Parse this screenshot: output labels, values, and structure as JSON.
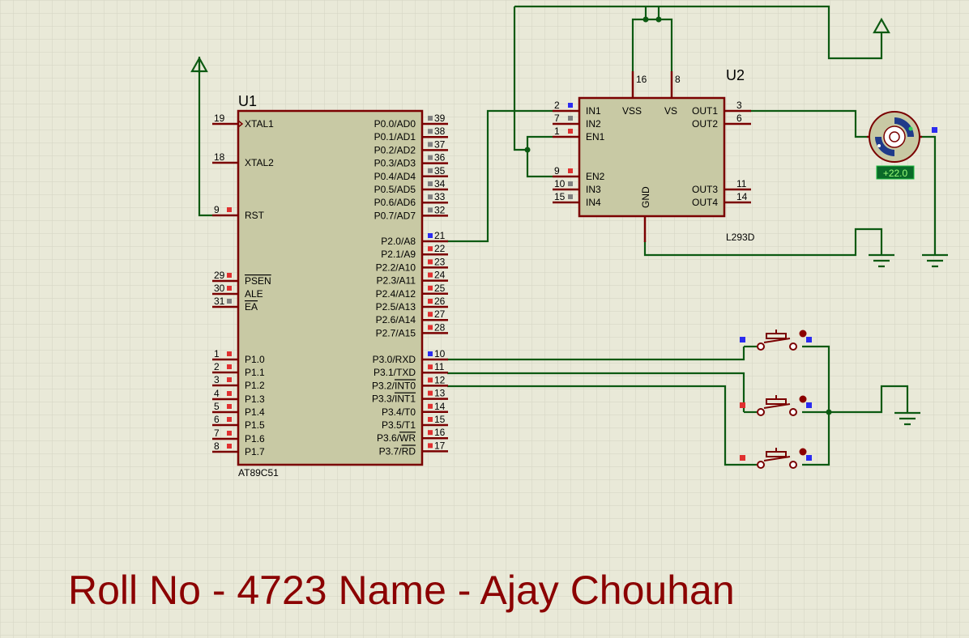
{
  "colors": {
    "background": "#e9e9d8",
    "grid": "#d4d4c2",
    "chip_fill": "#c8c9a4",
    "chip_border": "#7a0000",
    "wire": "#0c5a12",
    "footer_text": "#8b0000",
    "pin_marker_red": "#e03030",
    "pin_marker_blue": "#2b2bf0",
    "pin_marker_gray": "#808080"
  },
  "u1": {
    "ref": "U1",
    "part": "AT89C51",
    "left_pins": [
      {
        "num": "19",
        "label": "XTAL1",
        "clock": true
      },
      {
        "num": "18",
        "label": "XTAL2"
      },
      {
        "num": "9",
        "label": "RST",
        "marker": "red"
      },
      {
        "num": "29",
        "label": "PSEN",
        "overline": true,
        "marker": "red"
      },
      {
        "num": "30",
        "label": "ALE",
        "marker": "red"
      },
      {
        "num": "31",
        "label": "EA",
        "overline": true,
        "marker": "gray"
      },
      {
        "num": "1",
        "label": "P1.0",
        "marker": "red"
      },
      {
        "num": "2",
        "label": "P1.1",
        "marker": "red"
      },
      {
        "num": "3",
        "label": "P1.2",
        "marker": "red"
      },
      {
        "num": "4",
        "label": "P1.3",
        "marker": "red"
      },
      {
        "num": "5",
        "label": "P1.4",
        "marker": "red"
      },
      {
        "num": "6",
        "label": "P1.5",
        "marker": "red"
      },
      {
        "num": "7",
        "label": "P1.6",
        "marker": "red"
      },
      {
        "num": "8",
        "label": "P1.7",
        "marker": "red"
      }
    ],
    "right_pins": [
      {
        "num": "39",
        "label": "P0.0/AD0",
        "marker": "gray"
      },
      {
        "num": "38",
        "label": "P0.1/AD1",
        "marker": "gray"
      },
      {
        "num": "37",
        "label": "P0.2/AD2",
        "marker": "gray"
      },
      {
        "num": "36",
        "label": "P0.3/AD3",
        "marker": "gray"
      },
      {
        "num": "35",
        "label": "P0.4/AD4",
        "marker": "gray"
      },
      {
        "num": "34",
        "label": "P0.5/AD5",
        "marker": "gray"
      },
      {
        "num": "33",
        "label": "P0.6/AD6",
        "marker": "gray"
      },
      {
        "num": "32",
        "label": "P0.7/AD7",
        "marker": "gray"
      },
      {
        "num": "21",
        "label": "P2.0/A8",
        "marker": "blue"
      },
      {
        "num": "22",
        "label": "P2.1/A9",
        "marker": "red"
      },
      {
        "num": "23",
        "label": "P2.2/A10",
        "marker": "red"
      },
      {
        "num": "24",
        "label": "P2.3/A11",
        "marker": "red"
      },
      {
        "num": "25",
        "label": "P2.4/A12",
        "marker": "red"
      },
      {
        "num": "26",
        "label": "P2.5/A13",
        "marker": "red"
      },
      {
        "num": "27",
        "label": "P2.6/A14",
        "marker": "red"
      },
      {
        "num": "28",
        "label": "P2.7/A15",
        "marker": "red"
      },
      {
        "num": "10",
        "label": "P3.0/RXD",
        "marker": "blue"
      },
      {
        "num": "11",
        "label": "P3.1/TXD",
        "marker": "red"
      },
      {
        "num": "12",
        "label": "P3.2/",
        "over": "INT0",
        "marker": "red"
      },
      {
        "num": "13",
        "label": "P3.3/",
        "over": "INT1",
        "marker": "red"
      },
      {
        "num": "14",
        "label": "P3.4/T0",
        "marker": "red"
      },
      {
        "num": "15",
        "label": "P3.5/T1",
        "marker": "red"
      },
      {
        "num": "16",
        "label": "P3.6/",
        "over": "WR",
        "marker": "red"
      },
      {
        "num": "17",
        "label": "P3.7/",
        "over": "RD",
        "marker": "red"
      }
    ]
  },
  "u2": {
    "ref": "U2",
    "part": "L293D",
    "left_pins": [
      {
        "num": "2",
        "label": "IN1",
        "marker": "blue"
      },
      {
        "num": "7",
        "label": "IN2",
        "marker": "gray"
      },
      {
        "num": "1",
        "label": "EN1",
        "marker": "red"
      },
      {
        "num": "9",
        "label": "EN2",
        "marker": "red"
      },
      {
        "num": "10",
        "label": "IN3",
        "marker": "gray"
      },
      {
        "num": "15",
        "label": "IN4",
        "marker": "gray"
      }
    ],
    "right_pins": [
      {
        "num": "3",
        "label": "OUT1"
      },
      {
        "num": "6",
        "label": "OUT2"
      },
      {
        "num": "11",
        "label": "OUT3"
      },
      {
        "num": "14",
        "label": "OUT4"
      }
    ],
    "top_pins": [
      {
        "num": "16",
        "label": "VSS"
      },
      {
        "num": "8",
        "label": "VS"
      }
    ],
    "bottom_pin": {
      "label": "GND"
    }
  },
  "motor": {
    "readout": "+22.0"
  },
  "footer": {
    "text": "Roll No - 4723 Name - Ajay Chouhan"
  }
}
